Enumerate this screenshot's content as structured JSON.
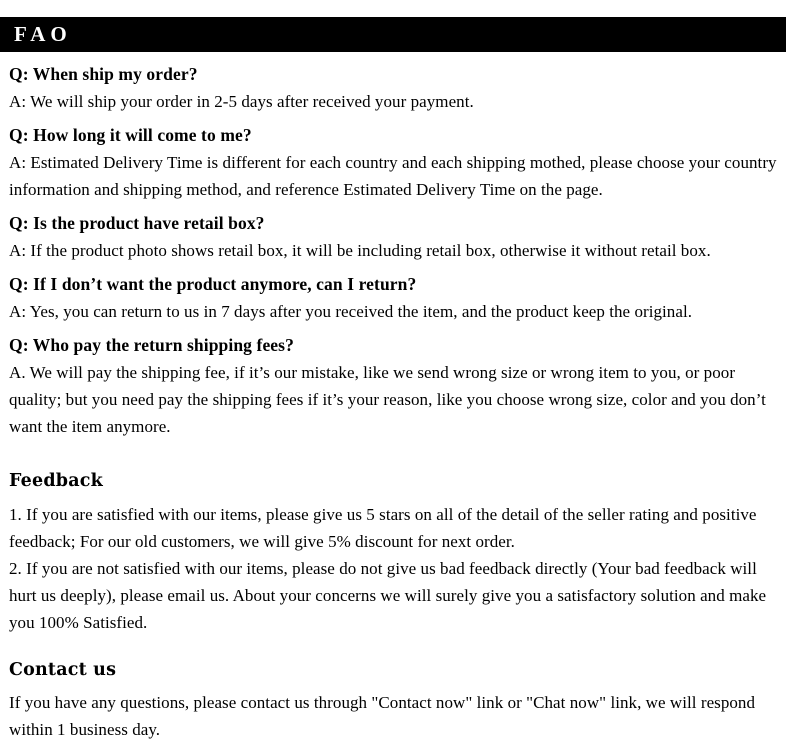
{
  "header": {
    "title": "FAO"
  },
  "faq": {
    "items": [
      {
        "question": "Q: When ship my order?",
        "answer": "A: We will ship your order in 2-5 days after received your payment."
      },
      {
        "question": "Q: How long it will come to me?",
        "answer": "A: Estimated Delivery Time is different for each country and each shipping mothed, please choose your country information and shipping method, and reference Estimated Delivery Time on the page."
      },
      {
        "question": "Q: Is the product have retail box?",
        "answer": "A: If  the product photo shows retail box, it will be including retail box, otherwise it without retail box."
      },
      {
        "question": "Q: If I don’t want the product anymore, can I return?",
        "answer": "A: Yes, you can return to us in 7 days after you received the item, and the product keep the original."
      },
      {
        "question": "Q: Who pay the return shipping fees?",
        "answer": "A. We will pay the shipping fee, if  it’s our mistake, like we send wrong size or wrong item to you, or poor quality; but you need pay the shipping fees if  it’s your reason, like you choose wrong size, color and you don’t want the item anymore."
      }
    ]
  },
  "feedback": {
    "heading": "Feedback",
    "items": [
      "1.  If you are satisfied with our items, please give us 5 stars on all of the detail of the seller rating and positive feedback; For our old customers, we will give 5% discount for next order.",
      "2.  If you are not satisfied with our items, please do not give us bad feedback directly (Your bad feedback will hurt us deeply), please email us. About your concerns we will surely give you a satisfactory solution and make you 100% Satisfied."
    ]
  },
  "contact": {
    "heading": "Contact us",
    "body": "If you have any questions, please contact us through \"Contact now\" link or \"Chat now\" link, we will respond within 1 business day."
  },
  "colors": {
    "header_background": "#000000",
    "header_text": "#ffffff",
    "body_text": "#000000",
    "page_background": "#ffffff"
  }
}
